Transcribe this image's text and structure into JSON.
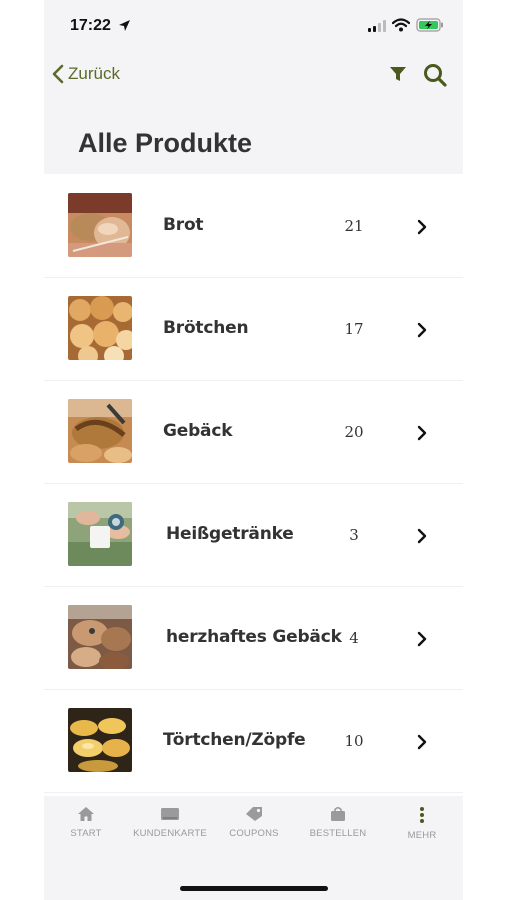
{
  "status": {
    "time": "17:22"
  },
  "nav": {
    "back_label": "Zurück"
  },
  "page": {
    "title": "Alle Produkte"
  },
  "products": [
    {
      "label": "Brot",
      "count": "21"
    },
    {
      "label": "Brötchen",
      "count": "17"
    },
    {
      "label": "Gebäck",
      "count": "20"
    },
    {
      "label": "Heißgetränke",
      "count": "3"
    },
    {
      "label": "herzhaftes Gebäck",
      "count": "4"
    },
    {
      "label": "Törtchen/Zöpfe",
      "count": "10"
    }
  ],
  "tabs": [
    {
      "label": "START",
      "icon": "home-icon"
    },
    {
      "label": "KUNDENKARTE",
      "icon": "card-icon"
    },
    {
      "label": "COUPONS",
      "icon": "tag-icon"
    },
    {
      "label": "BESTELLEN",
      "icon": "bag-icon"
    },
    {
      "label": "MEHR",
      "icon": "more-icon"
    }
  ],
  "colors": {
    "accent": "#5b6b2c",
    "tab_inactive": "#9a9a9a",
    "more_active": "#4a5a1e"
  }
}
